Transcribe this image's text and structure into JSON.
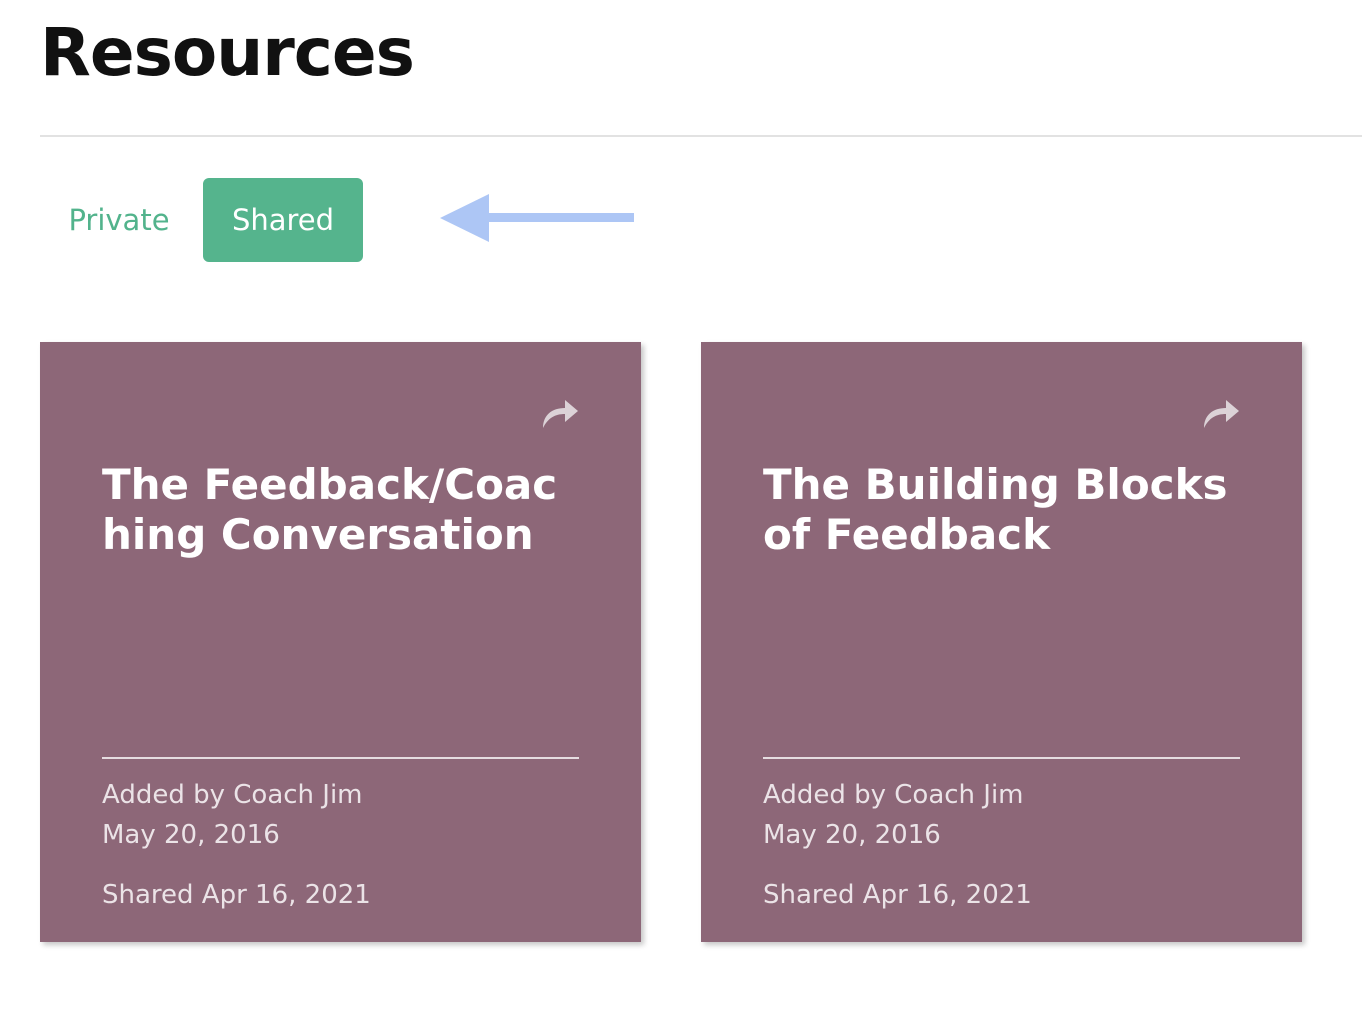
{
  "header": {
    "title": "Resources"
  },
  "tabs": [
    {
      "label": "Private",
      "active": false
    },
    {
      "label": "Shared",
      "active": true
    }
  ],
  "colors": {
    "accent": "#55b48d",
    "card_background": "#8d6778",
    "annotation_arrow": "#adc6f5"
  },
  "cards": [
    {
      "title": "The Feedback/Coaching Conversation",
      "share_icon": "share-arrow-icon",
      "added_by": "Added by Coach Jim",
      "date": "May 20, 2016",
      "shared": "Shared Apr 16, 2021"
    },
    {
      "title": "The Building Blocks of Feedback",
      "share_icon": "share-arrow-icon",
      "added_by": "Added by Coach Jim",
      "date": "May 20, 2016",
      "shared": "Shared Apr 16, 2021"
    }
  ]
}
